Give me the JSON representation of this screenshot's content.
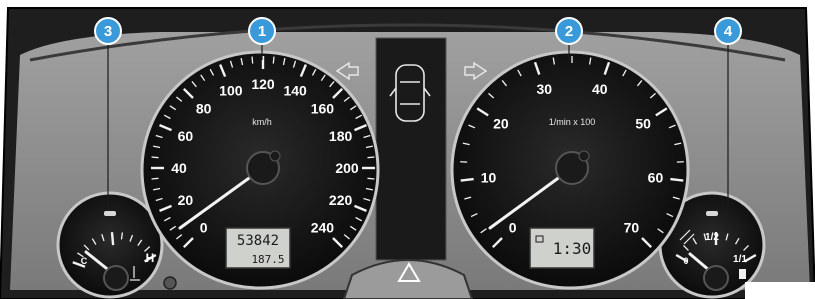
{
  "callouts": [
    "1",
    "2",
    "3",
    "4"
  ],
  "speedometer": {
    "unit": "km/h",
    "scale": [
      "0",
      "20",
      "40",
      "60",
      "80",
      "100",
      "120",
      "140",
      "160",
      "180",
      "200",
      "220",
      "240"
    ],
    "odometer": "53842",
    "trip": "187.5"
  },
  "tachometer": {
    "unit": "1/min x 100",
    "scale": [
      "0",
      "10",
      "20",
      "30",
      "40",
      "50",
      "60",
      "70"
    ],
    "clock": "1:30"
  },
  "temperature_gauge": {
    "low_mark": "C",
    "high_mark": "H"
  },
  "fuel_gauge": {
    "empty_mark": "0",
    "half_mark": "1/2",
    "full_mark": "1/1"
  },
  "icons": {
    "left": "turn-signal-left-icon",
    "right": "turn-signal-right-icon",
    "doors": "car-doors-icon",
    "hazard": "hazard-warning-icon"
  },
  "colors": {
    "callout_fill": "#3a9ad9",
    "panel": "#8c8c8c",
    "dial_face": "#101010"
  }
}
